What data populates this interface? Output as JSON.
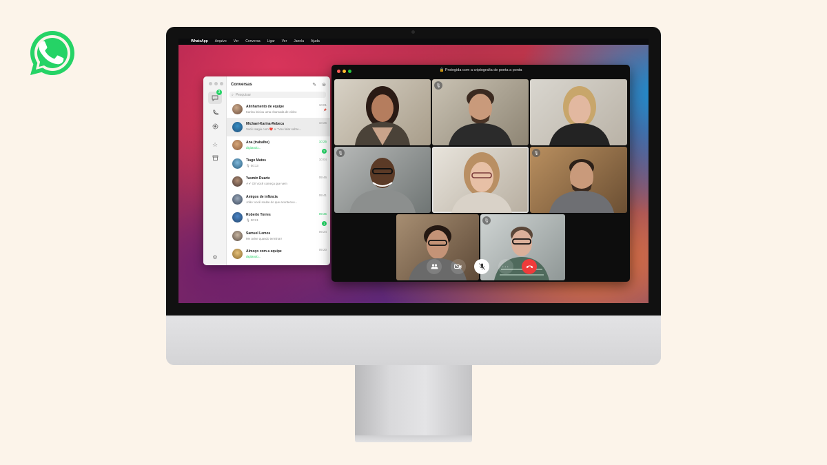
{
  "menubar": {
    "apple": "",
    "app_name": "WhatsApp",
    "items": [
      "Arquivo",
      "Ver",
      "Conversa",
      "Ligar",
      "Ver",
      "Janela",
      "Ajuda"
    ]
  },
  "chats": {
    "title": "Conversas",
    "search_placeholder": "Pesquisar",
    "rail_badge": "3",
    "items": [
      {
        "name": "Alinhamento de equipe",
        "preview": "Karina iniciou uma chamada de vídeo",
        "time": "10:01",
        "badge": "",
        "pinned": true
      },
      {
        "name": "Michael-Karina-Rebeca",
        "preview": "Você reagiu com ❤️ a: \"Vou falar sobre...",
        "time": "10:26",
        "badge": "",
        "pinned": false
      },
      {
        "name": "Ana (trabalho)",
        "preview": "digitando...",
        "time": "10:25",
        "badge": "2",
        "pinned": false
      },
      {
        "name": "Tiago Matos",
        "preview": "🎙 00:13",
        "time": "10:04",
        "badge": "",
        "pinned": false
      },
      {
        "name": "Yasmin Duarte",
        "preview": "✔✔ Oi! Você começa que vem",
        "time": "09:46",
        "badge": "",
        "pinned": false
      },
      {
        "name": "Amigos de infância",
        "preview": "João: você soube do que aconteceu...",
        "time": "09:41",
        "badge": "",
        "pinned": false
      },
      {
        "name": "Roberto Torres",
        "preview": "🎙 00:21",
        "time": "09:35",
        "badge": "1",
        "pinned": false
      },
      {
        "name": "Samuel Lemos",
        "preview": "Me avise quando terminar!",
        "time": "09:24",
        "badge": "",
        "pinned": false
      },
      {
        "name": "Almoço com a equipe",
        "preview": "digitando...",
        "time": "09:20",
        "badge": "",
        "pinned": false
      }
    ]
  },
  "call": {
    "title": "🔒 Protegida com a criptografia de ponta a ponta"
  },
  "colors": {
    "accent": "#25d366",
    "end_call": "#ef3b3b",
    "background": "#fcf4ea"
  }
}
